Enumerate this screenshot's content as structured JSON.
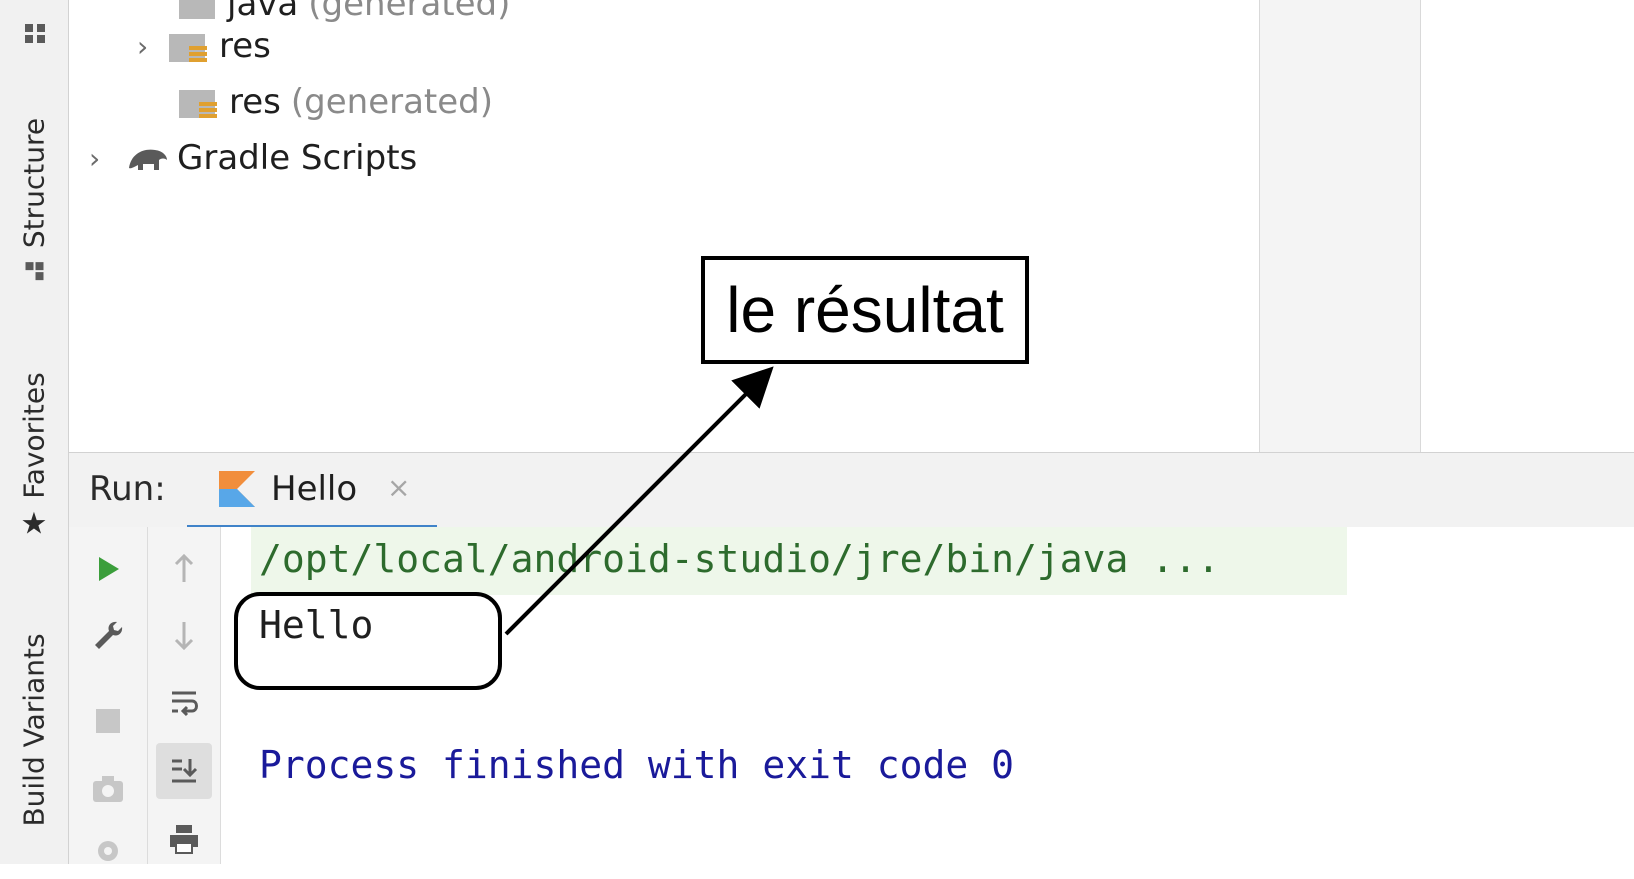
{
  "left_strip": {
    "tabs": [
      {
        "label": "Structure",
        "icon": "structure-icon"
      },
      {
        "label": "Favorites",
        "icon": "star-icon"
      },
      {
        "label": "Build Variants",
        "icon": "build-variants-icon"
      }
    ]
  },
  "tree": {
    "rows": [
      {
        "label": "java",
        "suffix": "(generated)",
        "icon": "folder-icon",
        "expandable": false
      },
      {
        "label": "res",
        "suffix": "",
        "icon": "resource-folder-icon",
        "expandable": true
      },
      {
        "label": "res",
        "suffix": "(generated)",
        "icon": "resource-folder-icon",
        "expandable": false
      },
      {
        "label": "Gradle Scripts",
        "suffix": "",
        "icon": "gradle-elephant-icon",
        "expandable": true
      }
    ]
  },
  "run": {
    "title": "Run:",
    "tab_label": "Hello",
    "tab_icon": "kotlin-icon",
    "close_glyph": "×",
    "console": {
      "command": "/opt/local/android-studio/jre/bin/java ...",
      "output": "Hello",
      "exit_message": "Process finished with exit code 0"
    },
    "toolbar_left": [
      "run-icon",
      "wrench-icon",
      "stop-icon",
      "camera-icon",
      "settings-icon"
    ],
    "toolbar_right": [
      "arrow-up-icon",
      "arrow-down-icon",
      "soft-wrap-icon",
      "scroll-to-end-icon",
      "print-icon"
    ]
  },
  "annotation": {
    "label": "le résultat"
  },
  "colors": {
    "accent": "#4083c9",
    "run_green": "#3b9e3b",
    "exit_text": "#1a1a9a",
    "cmd_text": "#2d6b2d",
    "cmd_bg": "#eef7ea"
  }
}
